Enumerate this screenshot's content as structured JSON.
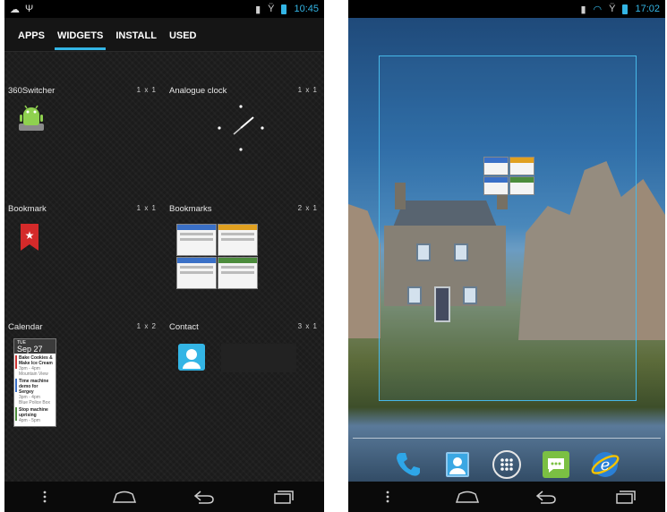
{
  "left": {
    "status": {
      "time": "10:45"
    },
    "tabs": [
      {
        "label": "APPS",
        "active": false
      },
      {
        "label": "WIDGETS",
        "active": true
      },
      {
        "label": "INSTALL",
        "active": false
      },
      {
        "label": "USED",
        "active": false
      }
    ],
    "widgets": [
      {
        "name": "360Switcher",
        "size": "1 x 1",
        "icon": "android-switch-icon"
      },
      {
        "name": "Analogue clock",
        "size": "1 x 1",
        "icon": "analog-clock-icon"
      },
      {
        "name": "Bookmark",
        "size": "1 x 1",
        "icon": "bookmark-ribbon-icon"
      },
      {
        "name": "Bookmarks",
        "size": "2 x 1",
        "icon": "bookmarks-thumbnails"
      },
      {
        "name": "Calendar",
        "size": "1 x 2",
        "icon": "calendar-preview"
      },
      {
        "name": "Contact",
        "size": "3 x 1",
        "icon": "contact-icon"
      }
    ],
    "calendar_preview": {
      "day": "TUE",
      "date": "Sep 27",
      "events": [
        {
          "title": "Bake Cookies & Make Ice Cream",
          "time": "3pm - 4pm",
          "place": "Mountain View"
        },
        {
          "title": "Time machine demo for Sergey",
          "time": "3pm - 4pm",
          "place": "Blue Police Box"
        },
        {
          "title": "Stop machine uprising",
          "time": "4pm - 5pm",
          "place": ""
        }
      ]
    }
  },
  "right": {
    "status": {
      "time": "17:02"
    },
    "dock_icons": [
      "phone-icon",
      "contacts-icon",
      "all-apps-icon",
      "messaging-icon",
      "browser-icon"
    ]
  },
  "colors": {
    "accent": "#33b5e5",
    "frame": "#47b8e8"
  }
}
